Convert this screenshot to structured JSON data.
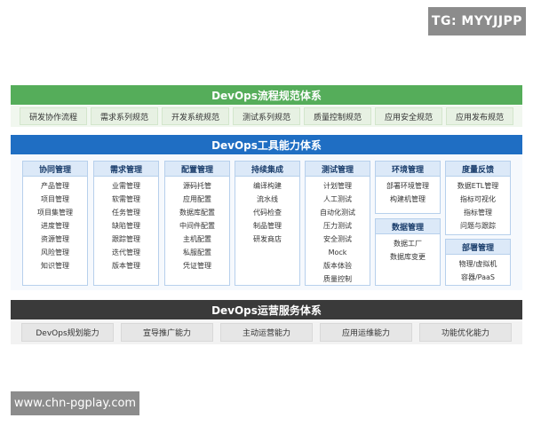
{
  "watermark_top": "TG: MYYJJPP",
  "watermark_bottom": "www.chn-pgplay.com",
  "process": {
    "title": "DevOps流程规范体系",
    "items": [
      "研发协作流程",
      "需求系列规范",
      "开发系统规范",
      "测试系列规范",
      "质量控制规范",
      "应用安全规范",
      "应用发布规范"
    ]
  },
  "tools": {
    "title": "DevOps工具能力体系",
    "columns": [
      {
        "title": "协同管理",
        "items": [
          "产品管理",
          "项目管理",
          "项目集管理",
          "进度管理",
          "资源管理",
          "风险管理",
          "知识管理"
        ]
      },
      {
        "title": "需求管理",
        "items": [
          "业需管理",
          "软需管理",
          "任务管理",
          "缺陷管理",
          "跟踪管理",
          "迭代管理",
          "版本管理"
        ]
      },
      {
        "title": "配置管理",
        "items": [
          "源码托管",
          "应用配置",
          "数据库配置",
          "中间件配置",
          "主机配置",
          "私服配置",
          "凭证管理"
        ]
      },
      {
        "title": "持续集成",
        "items": [
          "编译构建",
          "流水线",
          "代码检查",
          "制品管理",
          "研发商店"
        ]
      },
      {
        "title": "测试管理",
        "items": [
          "计划管理",
          "人工测试",
          "自动化测试",
          "压力测试",
          "安全测试",
          "Mock",
          "版本体验",
          "质量控制"
        ]
      },
      {
        "title": "环境管理",
        "items": [
          "部署环境管理",
          "构建机管理"
        ]
      },
      {
        "title": "数据管理",
        "items": [
          "数据工厂",
          "数据库变更"
        ]
      },
      {
        "title": "度量反馈",
        "items": [
          "数据ETL管理",
          "指标可视化",
          "指标管理",
          "问题与跟踪"
        ]
      },
      {
        "title": "部署管理",
        "items": [
          "物理/虚拟机",
          "容器/PaaS"
        ]
      }
    ]
  },
  "ops": {
    "title": "DevOps运营服务体系",
    "items": [
      "DevOps规划能力",
      "宣导推广能力",
      "主动运营能力",
      "应用运维能力",
      "功能优化能力"
    ]
  }
}
